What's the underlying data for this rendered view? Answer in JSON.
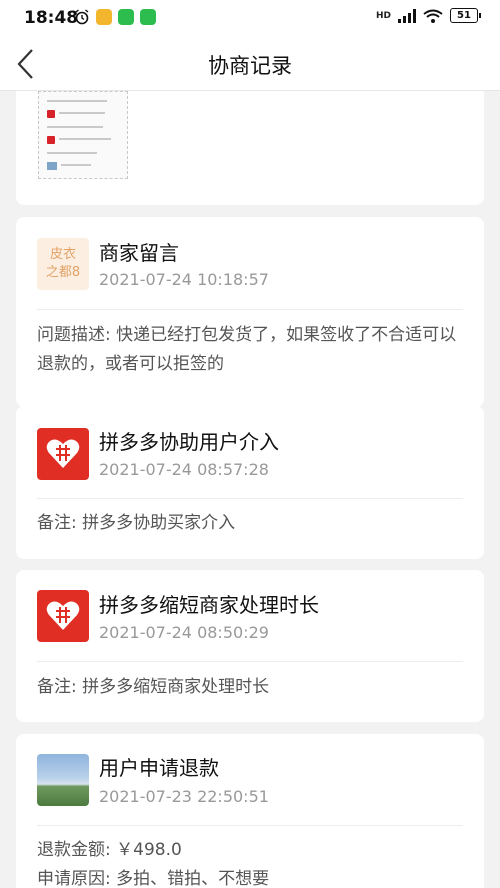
{
  "status_bar": {
    "time": "18:48",
    "battery": "51",
    "network": "HD"
  },
  "nav": {
    "title": "协商记录"
  },
  "records": [
    {
      "avatar_text": "皮衣\n之都8",
      "title": "商家留言",
      "time": "2021-07-24 10:18:57",
      "text": "问题描述: 快递已经打包发货了，如果签收了不合适可以退款的，或者可以拒签的"
    },
    {
      "avatar_icon": "pinduoduo-logo-icon",
      "title": "拼多多协助用户介入",
      "time": "2021-07-24 08:57:28",
      "text": "备注: 拼多多协助买家介入"
    },
    {
      "avatar_icon": "pinduoduo-logo-icon",
      "title": "拼多多缩短商家处理时长",
      "time": "2021-07-24 08:50:29",
      "text": "备注: 拼多多缩短商家处理时长"
    },
    {
      "avatar_icon": "user-photo-avatar",
      "title": "用户申请退款",
      "time": "2021-07-23 22:50:51",
      "refund_amount": "退款金额: ￥498.0",
      "reason": "申请原因: 多拍、错拍、不想要"
    }
  ],
  "colors": {
    "pdd_red": "#e02e24",
    "background": "#f2f2f2"
  }
}
